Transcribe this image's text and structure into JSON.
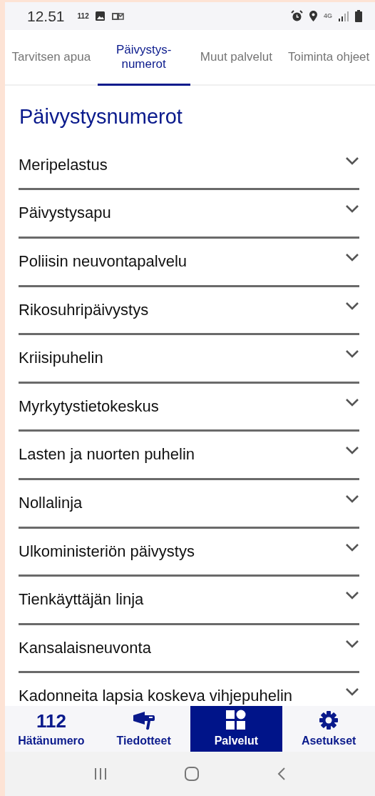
{
  "status_bar": {
    "time": "12.51",
    "notification_text": "112",
    "network": "4G"
  },
  "tabs": [
    {
      "label": "Tarvitsen apua",
      "selected": false
    },
    {
      "label": "Päivystys-numerot",
      "selected": true
    },
    {
      "label": "Muut palvelut",
      "selected": false
    },
    {
      "label": "Toiminta ohjeet",
      "selected": false
    }
  ],
  "heading": "Päivystysnumerot",
  "items": [
    {
      "label": "Meripelastus",
      "expanded": false
    },
    {
      "label": "Päivystysapu",
      "expanded": false
    },
    {
      "label": "Poliisin neuvontapalvelu",
      "expanded": false
    },
    {
      "label": "Rikosuhripäivystys",
      "expanded": false
    },
    {
      "label": "Kriisipuhelin",
      "expanded": false
    },
    {
      "label": "Myrkytystietokeskus",
      "expanded": false
    },
    {
      "label": "Lasten ja nuorten puhelin",
      "expanded": false
    },
    {
      "label": "Nollalinja",
      "expanded": false
    },
    {
      "label": "Ulkoministeriön päivystys",
      "expanded": false
    },
    {
      "label": "Tienkäyttäjän linja",
      "expanded": false
    },
    {
      "label": "Kansalaisneuvonta",
      "expanded": false
    },
    {
      "label": "Kadonneita lapsia koskeva vihjepuhelin",
      "expanded": false
    }
  ],
  "bottom_nav": [
    {
      "kind": "number",
      "icon_text": "112",
      "label": "Hätänumero",
      "selected": false
    },
    {
      "kind": "megaphone",
      "label": "Tiedotteet",
      "selected": false
    },
    {
      "kind": "grid",
      "label": "Palvelut",
      "selected": true
    },
    {
      "kind": "gear",
      "label": "Asetukset",
      "selected": false
    }
  ]
}
